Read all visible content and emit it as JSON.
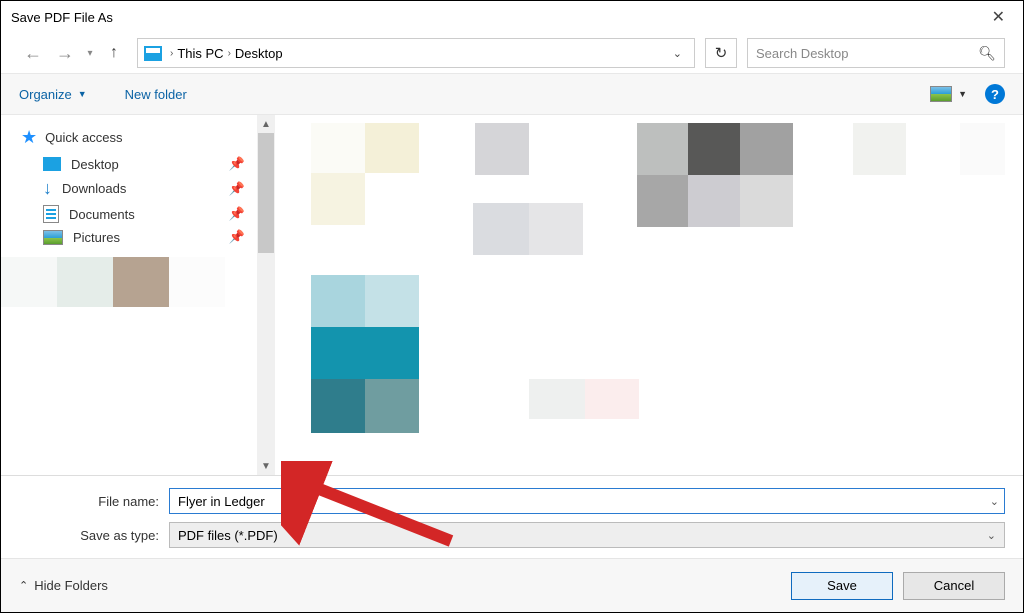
{
  "title": "Save PDF File As",
  "address": {
    "context": "This PC",
    "location": "Desktop"
  },
  "search": {
    "placeholder": "Search Desktop"
  },
  "toolbar": {
    "organize": "Organize",
    "new_folder": "New folder"
  },
  "sidebar": {
    "quick_access": "Quick access",
    "items": [
      {
        "label": "Desktop"
      },
      {
        "label": "Downloads"
      },
      {
        "label": "Documents"
      },
      {
        "label": "Pictures"
      }
    ]
  },
  "form": {
    "file_name_label": "File name:",
    "file_name_value": "Flyer in Ledger",
    "save_type_label": "Save as type:",
    "save_type_value": "PDF files (*.PDF)"
  },
  "footer": {
    "hide_folders": "Hide Folders",
    "save": "Save",
    "cancel": "Cancel"
  }
}
